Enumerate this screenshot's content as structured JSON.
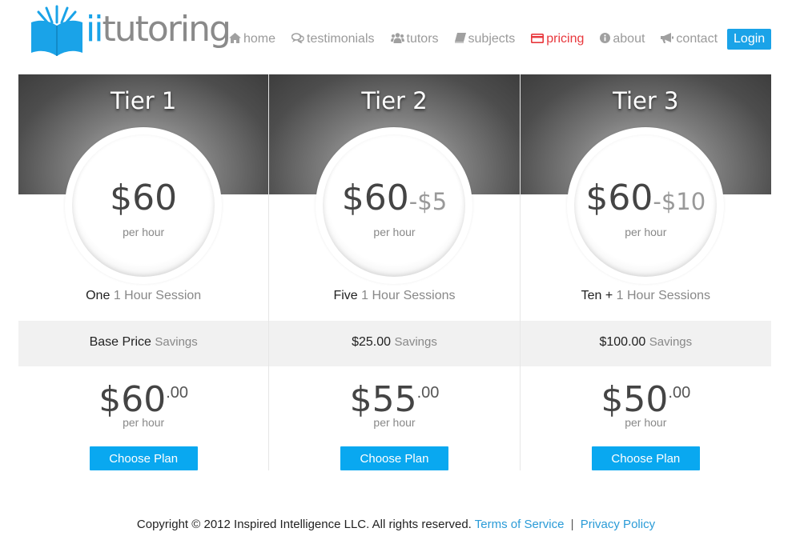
{
  "logo": {
    "text_ii": "ii",
    "text_rest": "tutoring",
    "icon": "open-book-icon",
    "brand_color": "#1aa3e8"
  },
  "nav": {
    "items": [
      {
        "label": "home",
        "icon": "house-icon",
        "active": false
      },
      {
        "label": "testimonials",
        "icon": "speech-bubbles-icon",
        "active": false
      },
      {
        "label": "tutors",
        "icon": "users-icon",
        "active": false
      },
      {
        "label": "subjects",
        "icon": "book-icon",
        "active": false
      },
      {
        "label": "pricing",
        "icon": "credit-card-icon",
        "active": true
      },
      {
        "label": "about",
        "icon": "info-circle-icon",
        "active": false
      },
      {
        "label": "contact",
        "icon": "bullhorn-icon",
        "active": false
      }
    ],
    "login_label": "Login",
    "active_color": "#e8373c"
  },
  "tiers": [
    {
      "title": "Tier 1",
      "circle_price": "$60",
      "circle_discount": "",
      "circle_sub": "per hour",
      "session_strong": "One",
      "session_light": "1 Hour Session",
      "savings_strong": "Base Price",
      "savings_light": "Savings",
      "price_amount": "$60",
      "price_cents": ".00",
      "price_sub": "per hour",
      "button_label": "Choose Plan"
    },
    {
      "title": "Tier 2",
      "circle_price": "$60",
      "circle_discount": "-$5",
      "circle_sub": "per hour",
      "session_strong": "Five",
      "session_light": "1 Hour Sessions",
      "savings_strong": "$25.00",
      "savings_light": "Savings",
      "price_amount": "$55",
      "price_cents": ".00",
      "price_sub": "per hour",
      "button_label": "Choose Plan"
    },
    {
      "title": "Tier 3",
      "circle_price": "$60",
      "circle_discount": "-$10",
      "circle_sub": "per hour",
      "session_strong": "Ten +",
      "session_light": "1 Hour Sessions",
      "savings_strong": "$100.00",
      "savings_light": "Savings",
      "price_amount": "$50",
      "price_cents": ".00",
      "price_sub": "per hour",
      "button_label": "Choose Plan"
    }
  ],
  "footer": {
    "copyright": "Copyright © 2012 Inspired Intelligence LLC. All rights reserved.",
    "terms_label": "Terms of Service",
    "separator": "|",
    "privacy_label": "Privacy Policy"
  }
}
